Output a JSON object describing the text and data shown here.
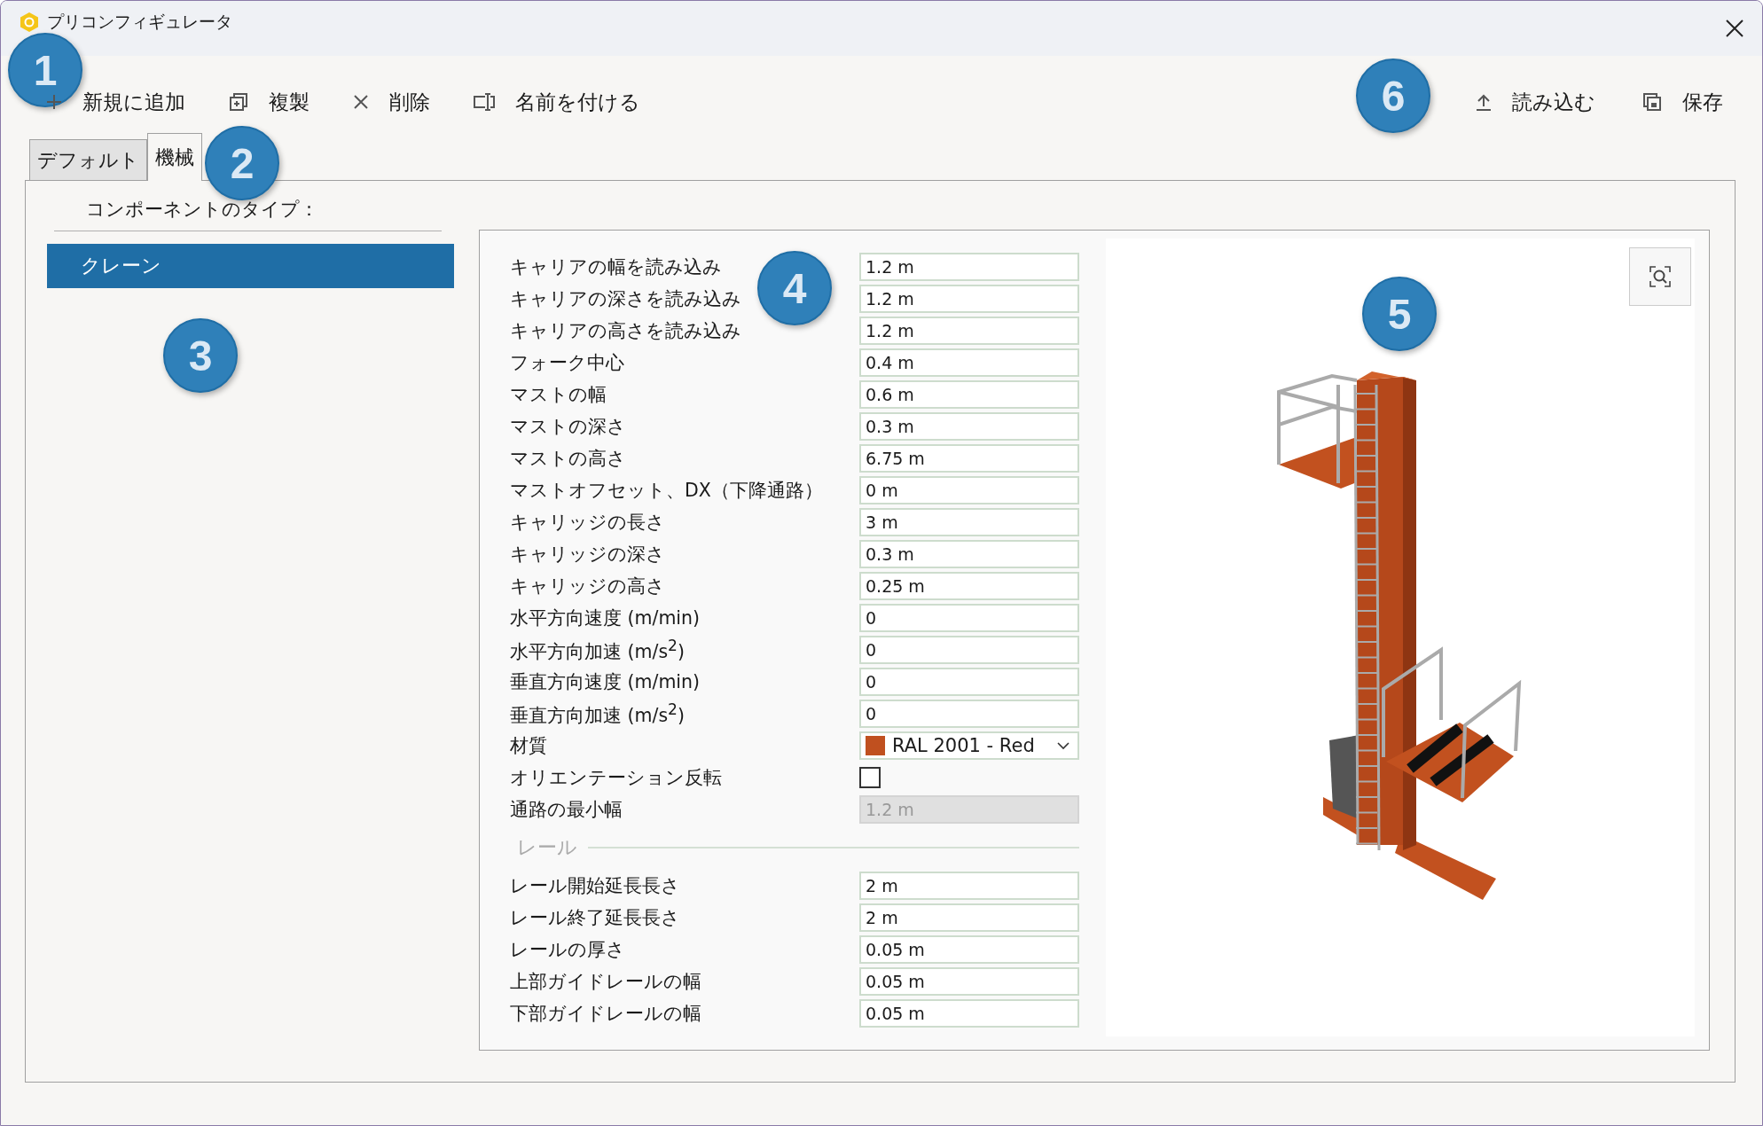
{
  "window": {
    "title": "プリコンフィギュレータ"
  },
  "toolbar": {
    "left": [
      {
        "kind": "add",
        "label": "新規に追加"
      },
      {
        "kind": "duplicate",
        "label": "複製"
      },
      {
        "kind": "delete",
        "label": "削除"
      },
      {
        "kind": "rename",
        "label": "名前を付ける"
      }
    ],
    "right": [
      {
        "kind": "import",
        "label": "読み込む"
      },
      {
        "kind": "save",
        "label": "保存"
      }
    ]
  },
  "tabs": [
    {
      "label": "デフォルト",
      "selected": false
    },
    {
      "label": "機械",
      "selected": true
    }
  ],
  "component_types": {
    "heading": "コンポーネントのタイプ：",
    "items": [
      {
        "label": "クレーン",
        "selected": true
      }
    ]
  },
  "properties": [
    {
      "kind": "text",
      "label": "キャリアの幅を読み込み",
      "value": "1.2 m",
      "disabled": false
    },
    {
      "kind": "text",
      "label": "キャリアの深さを読み込み",
      "value": "1.2 m",
      "disabled": false
    },
    {
      "kind": "text",
      "label": "キャリアの高さを読み込み",
      "value": "1.2 m",
      "disabled": false
    },
    {
      "kind": "text",
      "label": "フォーク中心",
      "value": "0.4 m",
      "disabled": false
    },
    {
      "kind": "text",
      "label": "マストの幅",
      "value": "0.6 m",
      "disabled": false
    },
    {
      "kind": "text",
      "label": "マストの深さ",
      "value": "0.3 m",
      "disabled": false
    },
    {
      "kind": "text",
      "label": "マストの高さ",
      "value": "6.75 m",
      "disabled": false
    },
    {
      "kind": "text",
      "label": "マストオフセット、DX（下降通路）",
      "value": "0 m",
      "disabled": false
    },
    {
      "kind": "text",
      "label": "キャリッジの長さ",
      "value": "3 m",
      "disabled": false
    },
    {
      "kind": "text",
      "label": "キャリッジの深さ",
      "value": "0.3 m",
      "disabled": false
    },
    {
      "kind": "text",
      "label": "キャリッジの高さ",
      "value": "0.25 m",
      "disabled": false
    },
    {
      "kind": "text",
      "label": "水平方向速度 (m/min)",
      "value": "0",
      "disabled": false
    },
    {
      "kind": "text",
      "label": "水平方向加速 (m/s$^{2}$)",
      "value": "0",
      "disabled": false
    },
    {
      "kind": "text",
      "label": "垂直方向速度 (m/min)",
      "value": "0",
      "disabled": false
    },
    {
      "kind": "text",
      "label": "垂直方向加速 (m/s$^{2}$)",
      "value": "0",
      "disabled": false
    },
    {
      "kind": "select",
      "label": "材質",
      "value": "RAL 2001 - Red",
      "color": "#c0501f",
      "disabled": false
    },
    {
      "kind": "checkbox",
      "label": "オリエンテーション反転",
      "checked": false,
      "disabled": false
    },
    {
      "kind": "text",
      "label": "通路の最小幅",
      "value": "1.2 m",
      "disabled": true
    }
  ],
  "rail_section": {
    "title": "レール",
    "properties": [
      {
        "kind": "text",
        "label": "レール開始延長長さ",
        "value": "2 m"
      },
      {
        "kind": "text",
        "label": "レール終了延長長さ",
        "value": "2 m"
      },
      {
        "kind": "text",
        "label": "レールの厚さ",
        "value": "0.05 m"
      },
      {
        "kind": "text",
        "label": "上部ガイドレールの幅",
        "value": "0.05 m"
      },
      {
        "kind": "text",
        "label": "下部ガイドレールの幅",
        "value": "0.05 m"
      }
    ]
  },
  "callouts": [
    "1",
    "2",
    "3",
    "4",
    "5",
    "6"
  ]
}
